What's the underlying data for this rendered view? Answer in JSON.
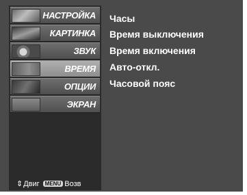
{
  "menu": {
    "items": [
      {
        "label": "НАСТРОЙКА",
        "icon": "setup-icon"
      },
      {
        "label": "КАРТИНКА",
        "icon": "picture-icon"
      },
      {
        "label": "ЗВУК",
        "icon": "sound-icon"
      },
      {
        "label": "ВРЕМЯ",
        "icon": "time-icon",
        "selected": true
      },
      {
        "label": "ОПЦИИ",
        "icon": "option-icon"
      },
      {
        "label": "ЭКРАН",
        "icon": "screen-icon"
      }
    ]
  },
  "submenu": {
    "items": [
      "Часы",
      "Время выключения",
      "Время включения",
      "Авто-откл.",
      "Часовой пояс"
    ]
  },
  "hint": {
    "move_icon": "updown-arrows-icon",
    "move_label": "Двиг",
    "menu_key": "MENU",
    "back_label": "Возв"
  }
}
